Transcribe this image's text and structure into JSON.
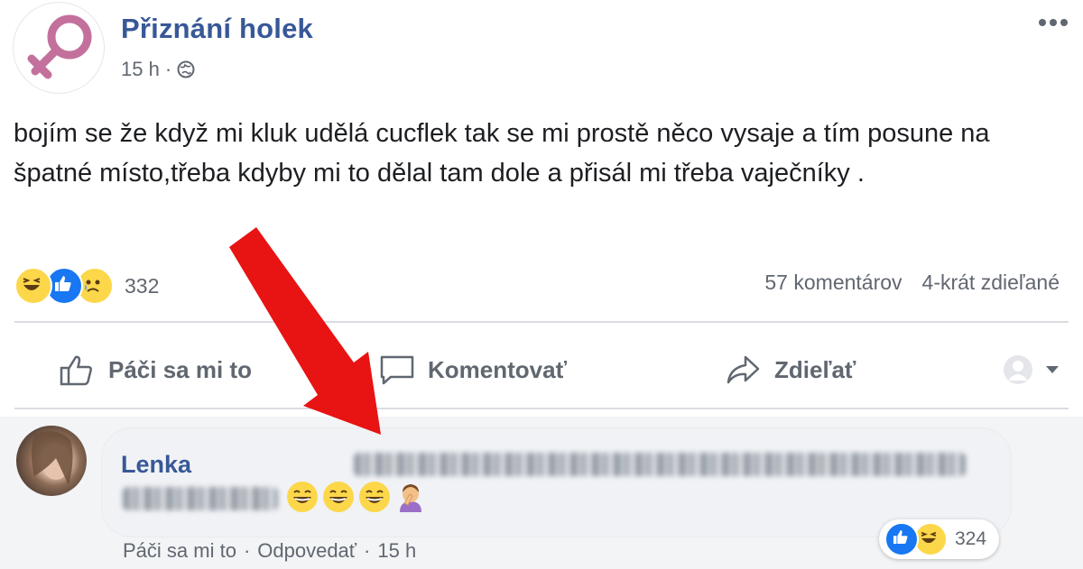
{
  "post": {
    "page_name": "Přiznání holek",
    "time": "15 h",
    "separator": "·",
    "text": "bojím se že když mi kluk udělá cucflek tak se mi prostě něco vysaje a tím posune na špatné místo,třeba kdyby mi to dělal tam dole a přisál mi třeba vaječníky ."
  },
  "stats": {
    "reaction_icons": [
      "haha-reaction-icon",
      "like-reaction-icon",
      "sad-reaction-icon"
    ],
    "reaction_count": "332",
    "comments": "57 komentárov",
    "shares": "4-krát zdieľané"
  },
  "actions": {
    "like": "Páči sa mi to",
    "comment": "Komentovať",
    "share": "Zdieľať"
  },
  "comment": {
    "author": "Lenka",
    "emojis": [
      "laughing-emoji",
      "laughing-emoji",
      "laughing-emoji",
      "facepalm-emoji"
    ],
    "reaction_count": "324",
    "like_label": "Páči sa mi to",
    "reply_label": "Odpovedať",
    "time": "15 h",
    "separator": "·"
  },
  "colors": {
    "brand_blue": "#385898",
    "muted_text": "#616770",
    "like_blue": "#1877f2",
    "reaction_yellow": "#fcd74a",
    "female_symbol_pink": "#c3709c",
    "arrow_red": "#e81313"
  }
}
